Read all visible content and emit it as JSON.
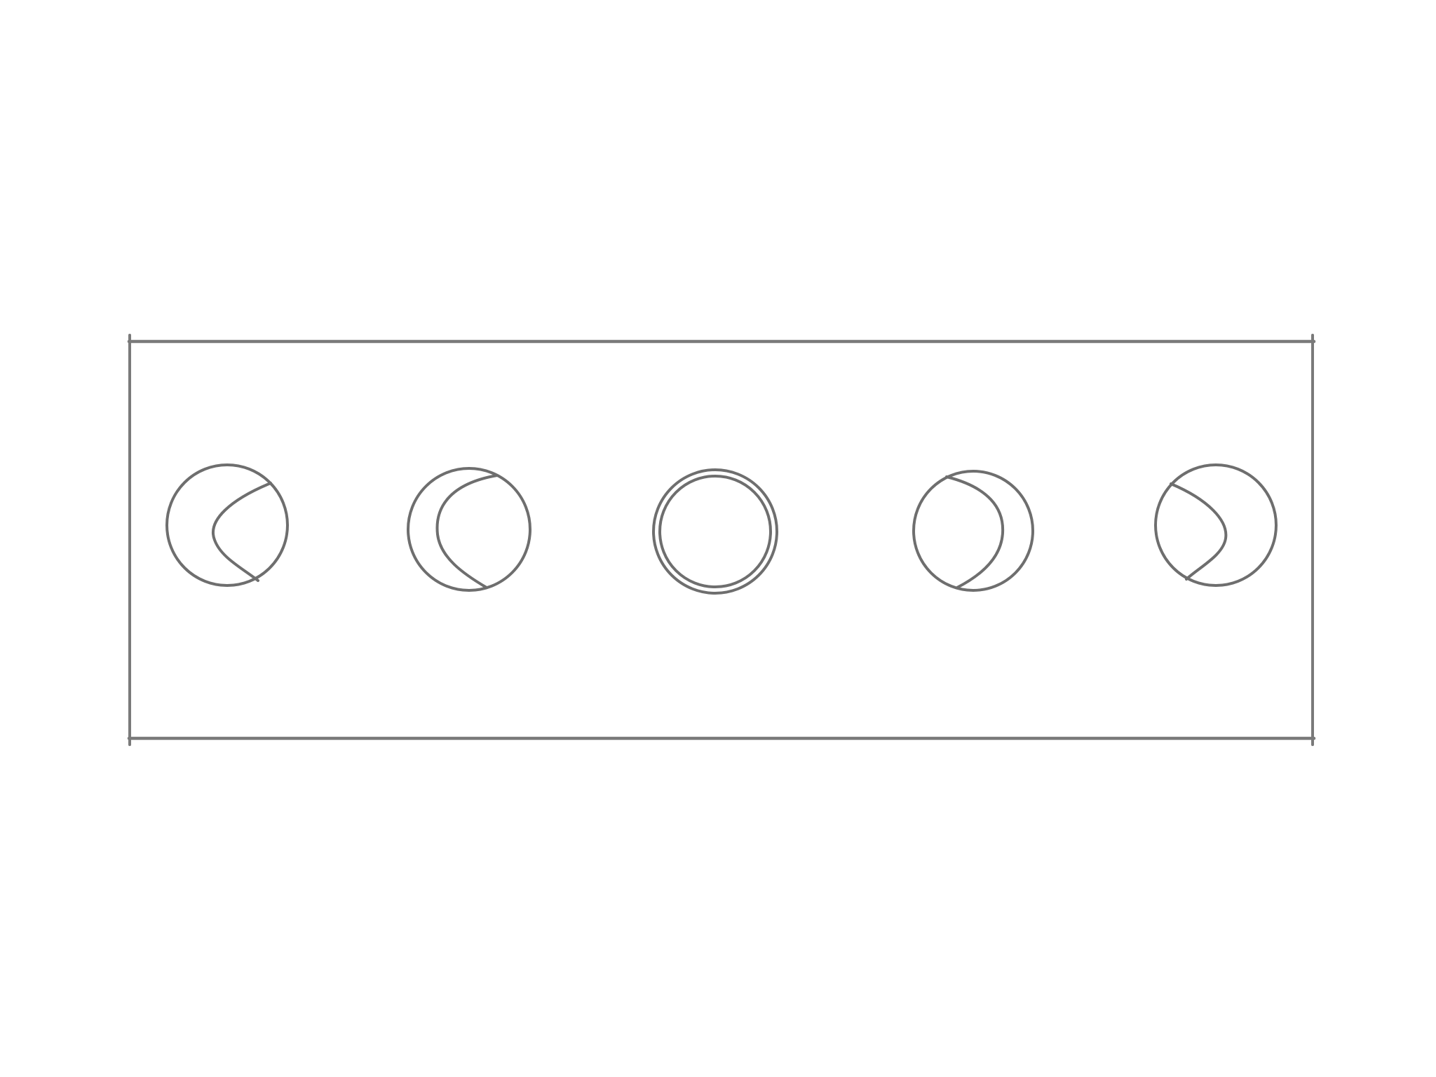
{
  "diagram": {
    "stroke_color": "#6e6e6e",
    "frame_color": "#7a7a7a",
    "background": "#ffffff",
    "phases": [
      {
        "name": "waxing-gibbous",
        "icon": "moon-waxing-gibbous-icon"
      },
      {
        "name": "waxing-crescent",
        "icon": "moon-waxing-crescent-icon"
      },
      {
        "name": "new-moon",
        "icon": "moon-new-icon"
      },
      {
        "name": "waning-crescent",
        "icon": "moon-waning-crescent-icon"
      },
      {
        "name": "waning-gibbous",
        "icon": "moon-waning-gibbous-icon"
      }
    ]
  }
}
